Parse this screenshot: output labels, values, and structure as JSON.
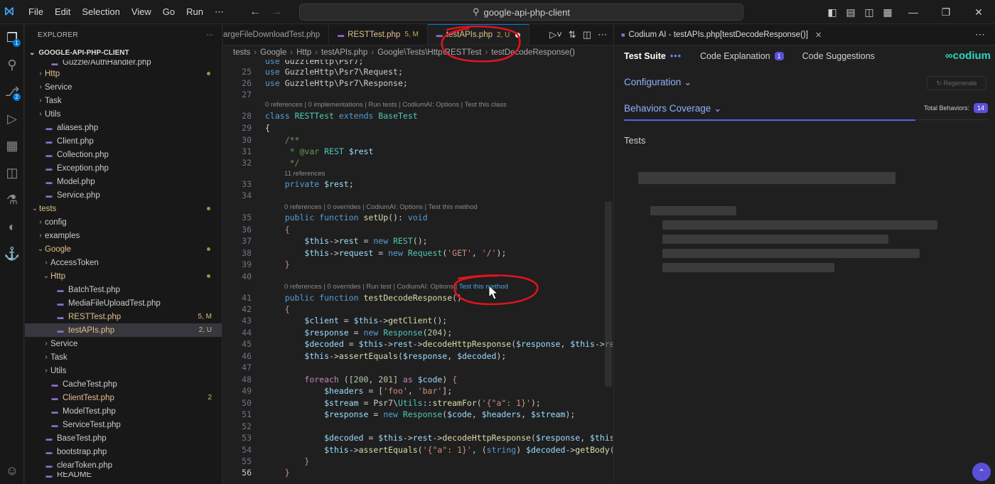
{
  "titlebar": {
    "menu": [
      "File",
      "Edit",
      "Selection",
      "View",
      "Go",
      "Run",
      "⋯"
    ],
    "search": "google-api-php-client"
  },
  "explorer": {
    "title": "EXPLORER",
    "project": "GOOGLE-API-PHP-CLIENT",
    "items": [
      {
        "label": "Guzzle/AuthHandler.php",
        "chev": "",
        "indent": 2,
        "file": true,
        "cut": true
      },
      {
        "label": "Http",
        "chev": "›",
        "indent": 1,
        "file": false,
        "mod": true,
        "dot": true
      },
      {
        "label": "Service",
        "chev": "›",
        "indent": 1,
        "file": false
      },
      {
        "label": "Task",
        "chev": "›",
        "indent": 1,
        "file": false
      },
      {
        "label": "Utils",
        "chev": "›",
        "indent": 1,
        "file": false
      },
      {
        "label": "aliases.php",
        "chev": "",
        "indent": 1,
        "file": true
      },
      {
        "label": "Client.php",
        "chev": "",
        "indent": 1,
        "file": true
      },
      {
        "label": "Collection.php",
        "chev": "",
        "indent": 1,
        "file": true
      },
      {
        "label": "Exception.php",
        "chev": "",
        "indent": 1,
        "file": true
      },
      {
        "label": "Model.php",
        "chev": "",
        "indent": 1,
        "file": true
      },
      {
        "label": "Service.php",
        "chev": "",
        "indent": 1,
        "file": true
      },
      {
        "label": "tests",
        "chev": "⌄",
        "indent": 0,
        "file": false,
        "mod": true,
        "dot": true
      },
      {
        "label": "config",
        "chev": "›",
        "indent": 1,
        "file": false
      },
      {
        "label": "examples",
        "chev": "›",
        "indent": 1,
        "file": false
      },
      {
        "label": "Google",
        "chev": "⌄",
        "indent": 1,
        "file": false,
        "mod": true,
        "dot": true
      },
      {
        "label": "AccessToken",
        "chev": "›",
        "indent": 2,
        "file": false
      },
      {
        "label": "Http",
        "chev": "⌄",
        "indent": 2,
        "file": false,
        "mod": true,
        "dot": true
      },
      {
        "label": "BatchTest.php",
        "chev": "",
        "indent": 3,
        "file": true
      },
      {
        "label": "MediaFileUploadTest.php",
        "chev": "",
        "indent": 3,
        "file": true
      },
      {
        "label": "RESTTest.php",
        "chev": "",
        "indent": 3,
        "file": true,
        "mod": true,
        "status": "5, M"
      },
      {
        "label": "testAPIs.php",
        "chev": "",
        "indent": 3,
        "file": true,
        "sel": true,
        "mod": true,
        "status": "2, U"
      },
      {
        "label": "Service",
        "chev": "›",
        "indent": 2,
        "file": false
      },
      {
        "label": "Task",
        "chev": "›",
        "indent": 2,
        "file": false
      },
      {
        "label": "Utils",
        "chev": "›",
        "indent": 2,
        "file": false
      },
      {
        "label": "CacheTest.php",
        "chev": "",
        "indent": 2,
        "file": true
      },
      {
        "label": "ClientTest.php",
        "chev": "",
        "indent": 2,
        "file": true,
        "mod": true,
        "status": "2"
      },
      {
        "label": "ModelTest.php",
        "chev": "",
        "indent": 2,
        "file": true
      },
      {
        "label": "ServiceTest.php",
        "chev": "",
        "indent": 2,
        "file": true
      },
      {
        "label": "BaseTest.php",
        "chev": "",
        "indent": 1,
        "file": true
      },
      {
        "label": "bootstrap.php",
        "chev": "",
        "indent": 1,
        "file": true
      },
      {
        "label": "clearToken.php",
        "chev": "",
        "indent": 1,
        "file": true
      },
      {
        "label": "README",
        "chev": "",
        "indent": 1,
        "file": true,
        "cut": true
      }
    ]
  },
  "editor": {
    "tabs": [
      {
        "label": "argeFileDownloadTest.php",
        "status": "",
        "active": false
      },
      {
        "label": "RESTTest.php",
        "status": "5, M",
        "active": false
      },
      {
        "label": "testAPIs.php",
        "status": "2, U",
        "active": true
      }
    ],
    "breadcrumb": [
      "tests",
      "Google",
      "Http",
      "testAPIs.php",
      "Google\\Tests\\Http\\RESTTest",
      "testDecodeResponse()"
    ],
    "lens": {
      "class": "0 references | 0 implementations | Run tests | CodiumAI: Options | Test this class",
      "refs11": "11 references",
      "setup": "0 references | 0 overrides | CodiumAI: Options | Test this method",
      "decode_a": "0 references | 0 overrides | Run test | CodiumAI: Options | ",
      "decode_b": "Test this method"
    }
  },
  "panel": {
    "tab_title": "Codium AI - testAPIs.php[testDecodeResponse()]",
    "nav": {
      "test_suite": "Test Suite",
      "code_explanation": "Code Explanation",
      "code_explanation_badge": "1",
      "code_suggestions": "Code Suggestions"
    },
    "logo": "codium",
    "configuration": "Configuration",
    "regenerate": "Regenerate",
    "behaviors": "Behaviors Coverage",
    "total_label": "Total Behaviors:",
    "total_value": "14",
    "tests": "Tests"
  }
}
